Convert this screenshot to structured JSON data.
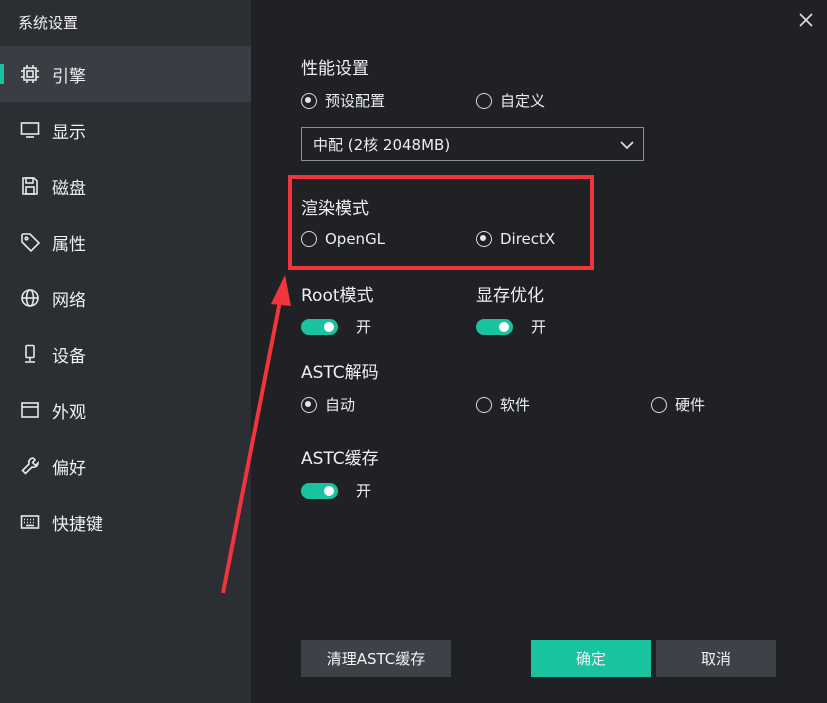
{
  "window": {
    "title": "系统设置"
  },
  "sidebar": {
    "items": [
      {
        "label": "引擎",
        "icon": "chip-icon",
        "active": true
      },
      {
        "label": "显示",
        "icon": "monitor-icon",
        "active": false
      },
      {
        "label": "磁盘",
        "icon": "save-icon",
        "active": false
      },
      {
        "label": "属性",
        "icon": "tag-icon",
        "active": false
      },
      {
        "label": "网络",
        "icon": "globe-icon",
        "active": false
      },
      {
        "label": "设备",
        "icon": "device-icon",
        "active": false
      },
      {
        "label": "外观",
        "icon": "window-icon",
        "active": false
      },
      {
        "label": "偏好",
        "icon": "wrench-icon",
        "active": false
      },
      {
        "label": "快捷键",
        "icon": "keyboard-icon",
        "active": false
      }
    ]
  },
  "performance": {
    "label": "性能设置",
    "options": {
      "preset": "预设配置",
      "custom": "自定义"
    },
    "selected": "preset",
    "select_value": "中配 (2核 2048MB)"
  },
  "render": {
    "label": "渲染模式",
    "options": {
      "opengl": "OpenGL",
      "directx": "DirectX"
    },
    "selected": "directx"
  },
  "root": {
    "label": "Root模式",
    "toggle_text": "开",
    "on": true
  },
  "vram": {
    "label": "显存优化",
    "toggle_text": "开",
    "on": true
  },
  "astc_decode": {
    "label": "ASTC解码",
    "options": {
      "auto": "自动",
      "software": "软件",
      "hardware": "硬件"
    },
    "selected": "auto"
  },
  "astc_cache": {
    "label": "ASTC缓存",
    "toggle_text": "开",
    "on": true
  },
  "buttons": {
    "clear": "清理ASTC缓存",
    "ok": "确定",
    "cancel": "取消"
  },
  "colors": {
    "accent": "#19c3a0",
    "annotation": "#f2353c",
    "sidebar": "#2b2e33",
    "content": "#1f2125"
  }
}
